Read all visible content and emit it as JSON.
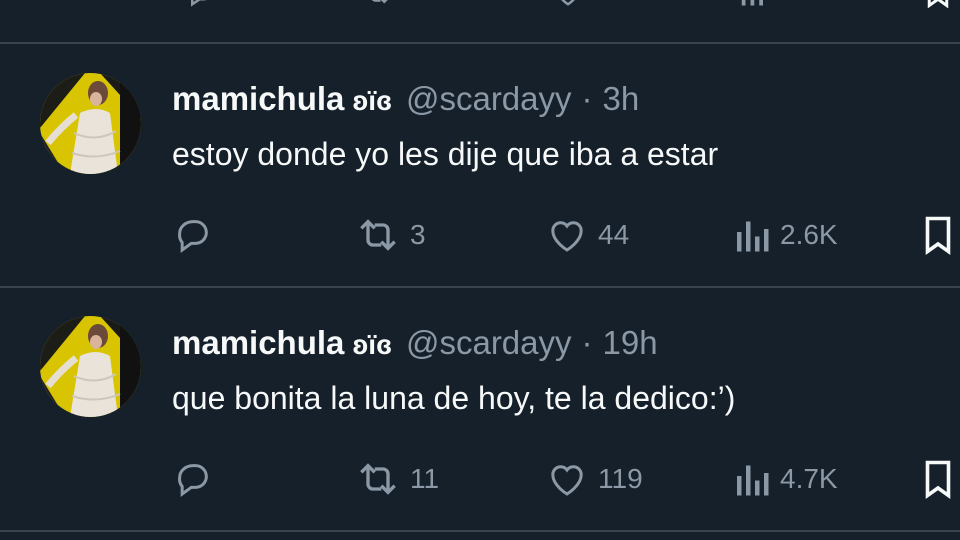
{
  "colors": {
    "background": "#15202b",
    "divider": "#38444d",
    "primary_text": "#f7f9f9",
    "secondary_text": "#8b98a5"
  },
  "tweets": [
    {
      "display_name": "mamichula",
      "name_emoji": "ʚïɞ",
      "handle": "@scardayy",
      "separator": "·",
      "time": "3h",
      "text": "estoy donde yo les dije que iba a estar",
      "actions": {
        "reply_icon": "reply-icon",
        "retweet_icon": "retweet-icon",
        "retweets": "3",
        "like_icon": "heart-icon",
        "likes": "44",
        "views_icon": "views-icon",
        "views": "2.6K",
        "bookmark_icon": "bookmark-icon"
      }
    },
    {
      "display_name": "mamichula",
      "name_emoji": "ʚïɞ",
      "handle": "@scardayy",
      "separator": "·",
      "time": "19h",
      "text": "que bonita la luna de hoy, te la dedico:’)",
      "actions": {
        "reply_icon": "reply-icon",
        "retweet_icon": "retweet-icon",
        "retweets": "11",
        "like_icon": "heart-icon",
        "likes": "119",
        "views_icon": "views-icon",
        "views": "4.7K",
        "bookmark_icon": "bookmark-icon"
      }
    }
  ]
}
